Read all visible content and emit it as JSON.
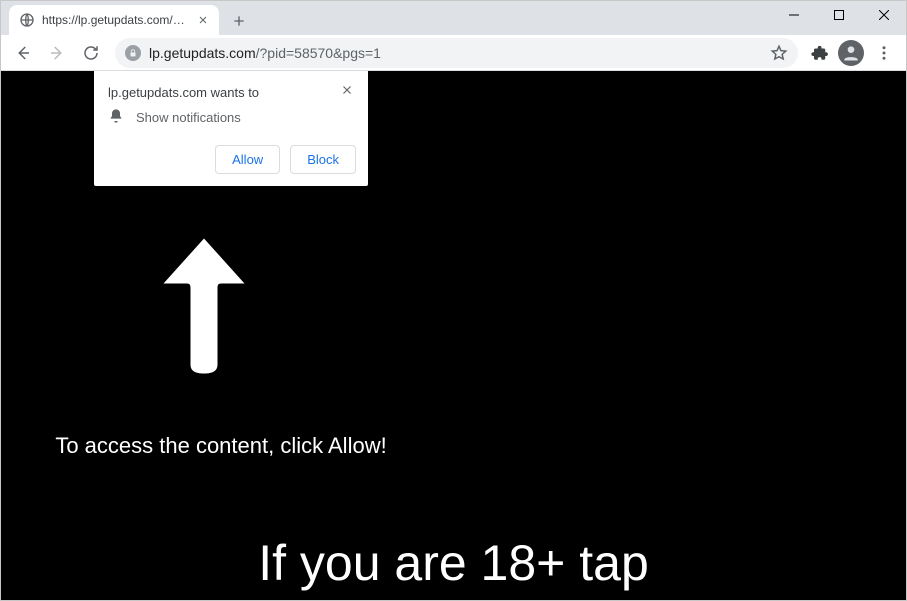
{
  "window": {
    "tab_title": "https://lp.getupdats.com/?pid=5"
  },
  "toolbar": {
    "url_host": "lp.getupdats.com",
    "url_path": "/?pid=58570&pgs=1"
  },
  "permission": {
    "origin_text": "lp.getupdats.com wants to",
    "request_text": "Show notifications",
    "allow_label": "Allow",
    "block_label": "Block"
  },
  "page": {
    "instruction": "To access the content, click Allow!",
    "headline": "If you are 18+ tap"
  }
}
